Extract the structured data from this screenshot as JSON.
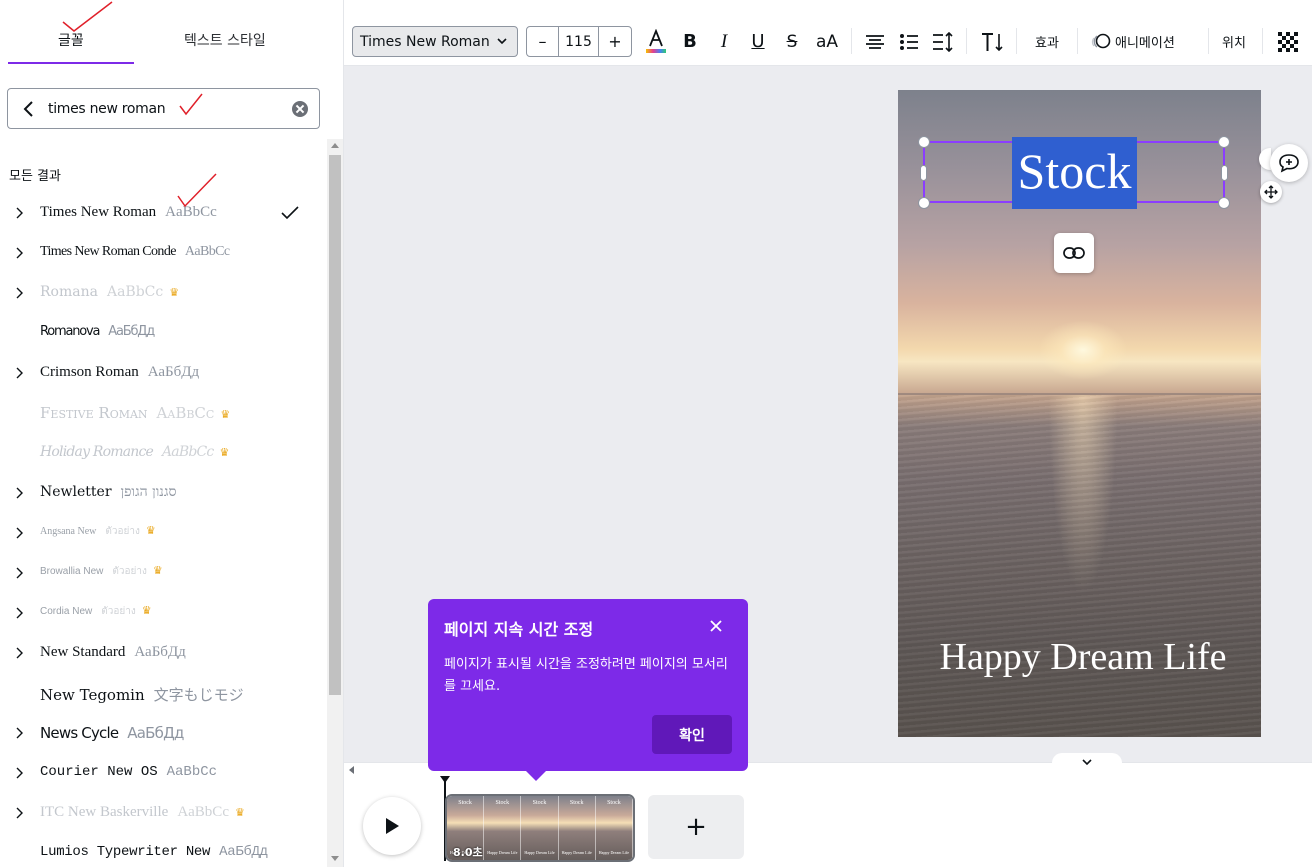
{
  "left_panel": {
    "tabs": {
      "font": "글꼴",
      "text_style": "텍스트 스타일"
    },
    "search": {
      "value": "times new roman",
      "placeholder": ""
    },
    "results_heading": "모든 결과",
    "fonts": [
      {
        "name": "Times New Roman",
        "sample": "AaBbCc",
        "has_variants": true,
        "premium": false,
        "selected": true
      },
      {
        "name": "Times New Roman Conde",
        "sample": "AaBbCc",
        "has_variants": true,
        "premium": false,
        "selected": false
      },
      {
        "name": "Romana",
        "sample": "AaBbCc",
        "has_variants": true,
        "premium": true,
        "selected": false
      },
      {
        "name": "Romanova",
        "sample": "АаБбДд",
        "has_variants": false,
        "premium": false,
        "selected": false
      },
      {
        "name": "Crimson Roman",
        "sample": "АаБбДд",
        "has_variants": true,
        "premium": false,
        "selected": false
      },
      {
        "name": "Festive Roman",
        "sample": "AaBbCc",
        "has_variants": false,
        "premium": true,
        "selected": false
      },
      {
        "name": "Holiday Romance",
        "sample": "AaBbCc",
        "has_variants": false,
        "premium": true,
        "selected": false
      },
      {
        "name": "Newletter",
        "sample": "סגנון הגופן",
        "has_variants": true,
        "premium": false,
        "selected": false
      },
      {
        "name": "Angsana New",
        "sample": "ตัวอย่าง",
        "has_variants": true,
        "premium": true,
        "selected": false
      },
      {
        "name": "Browallia New",
        "sample": "ตัวอย่าง",
        "has_variants": true,
        "premium": true,
        "selected": false
      },
      {
        "name": "Cordia New",
        "sample": "ตัวอย่าง",
        "has_variants": true,
        "premium": true,
        "selected": false
      },
      {
        "name": "New Standard",
        "sample": "АаБбДд",
        "has_variants": true,
        "premium": false,
        "selected": false
      },
      {
        "name": "New Tegomin",
        "sample": "文字もじモジ",
        "has_variants": false,
        "premium": false,
        "selected": false
      },
      {
        "name": "News Cycle",
        "sample": "АаБбДд",
        "has_variants": true,
        "premium": false,
        "selected": false
      },
      {
        "name": "Courier New OS",
        "sample": "AaBbCc",
        "has_variants": true,
        "premium": false,
        "selected": false
      },
      {
        "name": "ITC New Baskerville",
        "sample": "AaBbCc",
        "has_variants": true,
        "premium": true,
        "selected": false
      },
      {
        "name": "Lumios Typewriter New",
        "sample": "АаБбДд",
        "has_variants": false,
        "premium": false,
        "selected": false
      }
    ]
  },
  "toolbar": {
    "font_family": "Times New Roman",
    "font_size": "115",
    "minus": "–",
    "plus": "+",
    "bold": "B",
    "italic": "I",
    "underline": "U",
    "strike": "S",
    "case": "aA",
    "effects": "효과",
    "animation": "애니메이션",
    "position": "위치"
  },
  "canvas": {
    "title_text": "Stock",
    "subtitle_text": "Happy Dream Life"
  },
  "timeline": {
    "duration": "8.0초",
    "thumb_title": "Stock",
    "thumb_subtitle": "Happy Dream Life",
    "add_page": "+"
  },
  "tooltip": {
    "title": "페이지 지속 시간 조정",
    "body": "페이지가 표시될 시간을 조정하려면 페이지의 모서리를 끄세요.",
    "ok": "확인"
  },
  "colors": {
    "accent": "#7d2ae8",
    "selection": "#8b3dff",
    "text_highlight": "#2f5fd0",
    "premium_crown": "#e9a413",
    "annotation_red": "#e0202a"
  },
  "icons": [
    "back-arrow-icon",
    "clear-icon",
    "chevron-right-icon",
    "check-icon",
    "crown-icon",
    "dropdown-icon",
    "text-color-icon",
    "align-center-icon",
    "list-icon",
    "spacing-icon",
    "text-direction-icon",
    "animation-icon",
    "transparency-icon",
    "link-icon",
    "comment-add-icon",
    "move-icon",
    "play-icon",
    "close-icon"
  ]
}
